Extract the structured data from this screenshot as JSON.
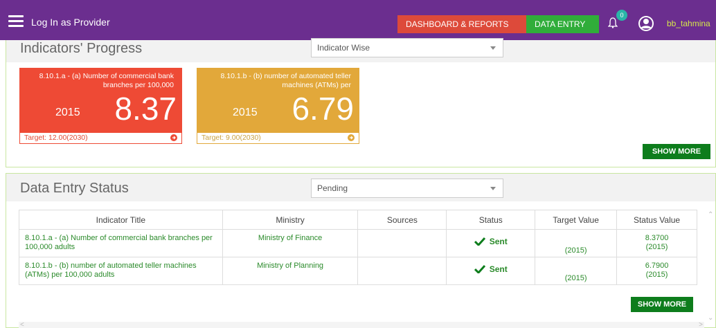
{
  "topbar": {
    "brand": "Log In as Provider",
    "nav_dashboard": "DASHBOARD & REPORTS",
    "nav_data_entry": "DATA ENTRY",
    "notification_count": "0",
    "username": "bb_tahmina",
    "colors": {
      "bar": "#6b2e8f",
      "dashboard": "#dd4a3a",
      "data_entry": "#30ad3a"
    }
  },
  "progress": {
    "title": "Indicators' Progress",
    "select_value": "Indicator Wise",
    "cards": [
      {
        "title": "8.10.1.a - (a) Number of commercial bank branches per 100,000",
        "year": "2015",
        "value": "8.37",
        "target": "Target: 12.00(2030)",
        "color": "#ee4a35"
      },
      {
        "title": "8.10.1.b - (b) number of automated teller machines (ATMs) per",
        "year": "2015",
        "value": "6.79",
        "target": "Target: 9.00(2030)",
        "color": "#e2a83a"
      }
    ],
    "show_more": "SHOW MORE"
  },
  "data_entry": {
    "title": "Data Entry Status",
    "select_value": "Pending",
    "columns": [
      "Indicator Title",
      "Ministry",
      "Sources",
      "Status",
      "Target Value",
      "Status Value"
    ],
    "rows": [
      {
        "indicator": "8.10.1.a - (a) Number of commercial bank branches per 100,000 adults",
        "ministry": "Ministry of Finance",
        "sources": "",
        "status": "Sent",
        "target": "(2015)",
        "status_value": "8.3700",
        "status_year": "(2015)"
      },
      {
        "indicator": "8.10.1.b - (b) number of automated teller machines (ATMs) per 100,000 adults",
        "ministry": "Ministry of Planning",
        "sources": "",
        "status": "Sent",
        "target": "(2015)",
        "status_value": "6.7900",
        "status_year": "(2015)"
      }
    ],
    "show_more": "SHOW MORE"
  }
}
